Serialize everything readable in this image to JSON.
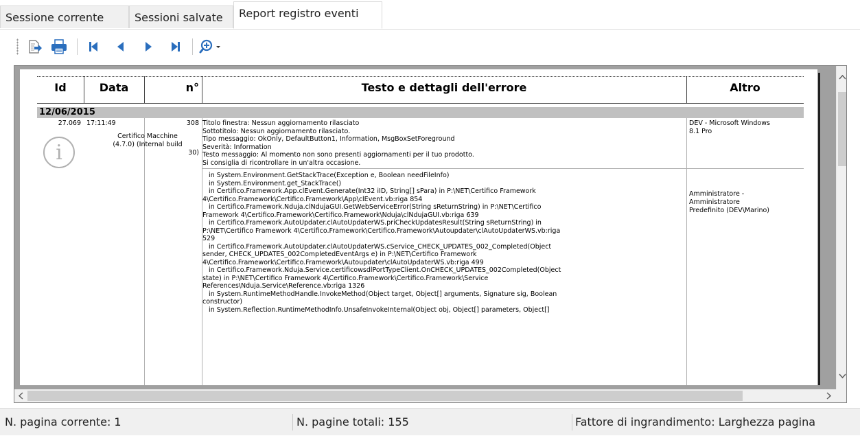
{
  "tabs": [
    {
      "label": "Sessione corrente"
    },
    {
      "label": "Sessioni salvate"
    },
    {
      "label": "Report registro eventi"
    }
  ],
  "toolbar": {
    "items": [
      "export-icon",
      "print-icon",
      "first-page-icon",
      "previous-page-icon",
      "next-page-icon",
      "last-page-icon",
      "zoom-icon",
      "dropdown-arrow-icon"
    ]
  },
  "report": {
    "headers": {
      "id": "Id",
      "data": "Data",
      "num": "n°",
      "text": "Testo e dettagli dell'errore",
      "other": "Altro"
    },
    "date_group": "12/06/2015",
    "entry": {
      "id": "27.069",
      "time": "17:11:49",
      "num": "308",
      "source_1": "Certifico Macchine",
      "source_2": "(4.7.0) (Internal build",
      "source_3": "30)",
      "other_1": "DEV - Microsoft Windows",
      "other_2": "8.1 Pro",
      "user_1": "Amministratore -",
      "user_2": "Amministratore",
      "user_3": "Predefinito (DEV\\Marino)",
      "message_lines": [
        "Titolo finestra: Nessun aggiornamento rilasciato",
        "Sottotitolo: Nessun aggiornamento rilasciato.",
        "Tipo messaggio: OkOnly, DefaultButton1, Information, MsgBoxSetForeground",
        "Severità: Information",
        "Testo messaggio: Al momento non sono presenti aggiornamenti per il tuo prodotto.",
        "Si consiglia di ricontrollare in un'altra occasione."
      ],
      "stack_lines": [
        "   in System.Environment.GetStackTrace(Exception e, Boolean needFileInfo)",
        "   in System.Environment.get_StackTrace()",
        "   in Certifico.Framework.App.clEvent.Generate(Int32 iID, String[] sPara) in P:\\NET\\Certifico Framework",
        "4\\Certifico.Framework\\Certifico.Framework\\App\\clEvent.vb:riga 854",
        "   in Certifico.Framework.Nduja.clNdujaGUI.GetWebServiceError(String sReturnString) in P:\\NET\\Certifico",
        "Framework 4\\Certifico.Framework\\Certifico.Framework\\Nduja\\clNdujaGUI.vb:riga 639",
        "   in Certifico.Framework.AutoUpdater.clAutoUpdaterWS.priCheckUpdatesResult(String sReturnString) in",
        "P:\\NET\\Certifico Framework 4\\Certifico.Framework\\Certifico.Framework\\Autoupdater\\clAutoUpdaterWS.vb:riga",
        "529",
        "   in Certifico.Framework.AutoUpdater.clAutoUpdaterWS.cService_CHECK_UPDATES_002_Completed(Object",
        "sender, CHECK_UPDATES_002CompletedEventArgs e) in P:\\NET\\Certifico Framework",
        "4\\Certifico.Framework\\Certifico.Framework\\Autoupdater\\clAutoUpdaterWS.vb:riga 499",
        "   in Certifico.Framework.Nduja.Service.certificowsdlPortTypeClient.OnCHECK_UPDATES_002Completed(Object",
        "state) in P:\\NET\\Certifico Framework 4\\Certifico.Framework\\Certifico.Framework\\Service",
        "References\\Nduja.Service\\Reference.vb:riga 1326",
        "   in System.RuntimeMethodHandle.InvokeMethod(Object target, Object[] arguments, Signature sig, Boolean",
        "constructor)",
        "   in System.Reflection.RuntimeMethodInfo.UnsafeInvokeInternal(Object obj, Object[] parameters, Object[]"
      ]
    }
  },
  "status": {
    "current_page": "N. pagina corrente: 1",
    "total_pages": "N. pagine totali: 155",
    "zoom": "Fattore di ingrandimento: Larghezza pagina"
  }
}
